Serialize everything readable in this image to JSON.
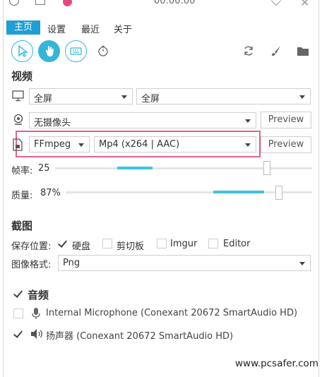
{
  "titlebar": {
    "timer": "00:00:00"
  },
  "tabs": [
    {
      "label": "主页"
    },
    {
      "label": "设置"
    },
    {
      "label": "最近"
    },
    {
      "label": "关于"
    }
  ],
  "video": {
    "heading": "视频",
    "screen_source": "全屏",
    "screen_region": "全屏",
    "webcam": "无摄像头",
    "preview_label": "Preview",
    "writer": "FFmpeg",
    "codec": "Mp4 (x264 | AAC)",
    "framerate_label": "帧率:",
    "framerate_value": "25",
    "quality_label": "质量:",
    "quality_value": "87%",
    "framerate_level": 0.37,
    "quality_level": 0.87
  },
  "screenshot": {
    "heading": "截图",
    "save_location_label": "保存位置:",
    "targets": [
      {
        "label": "硬盘",
        "checked": true
      },
      {
        "label": "剪切板",
        "checked": false
      },
      {
        "label": "Imgur",
        "checked": false
      },
      {
        "label": "Editor",
        "checked": false
      }
    ],
    "format_label": "图像格式:",
    "format_value": "Png"
  },
  "audio": {
    "heading": "音频",
    "heading_checked": true,
    "microphone_label": "Internal Microphone (Conexant 20672 SmartAudio HD)",
    "microphone_checked": false,
    "speaker_label": "扬声器 (Conexant 20672 SmartAudio HD)",
    "speaker_checked": true
  },
  "watermark": "www.pcsafer.com",
  "colors": {
    "accent": "#36b5dc",
    "tab_active_bg": "#1e9fd6",
    "highlight_box": "#e0648a",
    "record_dot": "#e5497a"
  }
}
